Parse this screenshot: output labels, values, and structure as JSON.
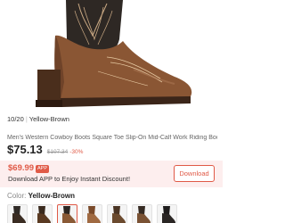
{
  "product": {
    "image_counter": "10/20",
    "image_color_name": "Yellow-Brown",
    "title": "Men's Western Cowboy Boots Square Toe Slip-On Mid-Calf Work Riding Boots",
    "price": "$75.13",
    "original_price": "$107.34",
    "discount": "-30%"
  },
  "app_banner": {
    "app_price": "$69.99",
    "badge": "APP",
    "text": "Download APP to Enjoy Instant Discount!",
    "button_label": "Download"
  },
  "color": {
    "label": "Color:",
    "value": "Yellow-Brown"
  },
  "swatches": [
    {
      "shaft": "#2f2a26",
      "foot": "#3a2c22",
      "selected": false
    },
    {
      "shaft": "#3a2a1e",
      "foot": "#5a3a22",
      "selected": false
    },
    {
      "shaft": "#2c2622",
      "foot": "#8a5a36",
      "selected": true
    },
    {
      "shaft": "#7a4a2a",
      "foot": "#a06a42",
      "selected": false
    },
    {
      "shaft": "#4a3424",
      "foot": "#6b4a2e",
      "selected": false
    },
    {
      "shaft": "#352a22",
      "foot": "#7a5234",
      "selected": false
    },
    {
      "shaft": "#1e1c1c",
      "foot": "#2a2624",
      "selected": false
    }
  ],
  "colors": {
    "accent": "#e05a47",
    "banner_bg": "#fdeeee"
  }
}
